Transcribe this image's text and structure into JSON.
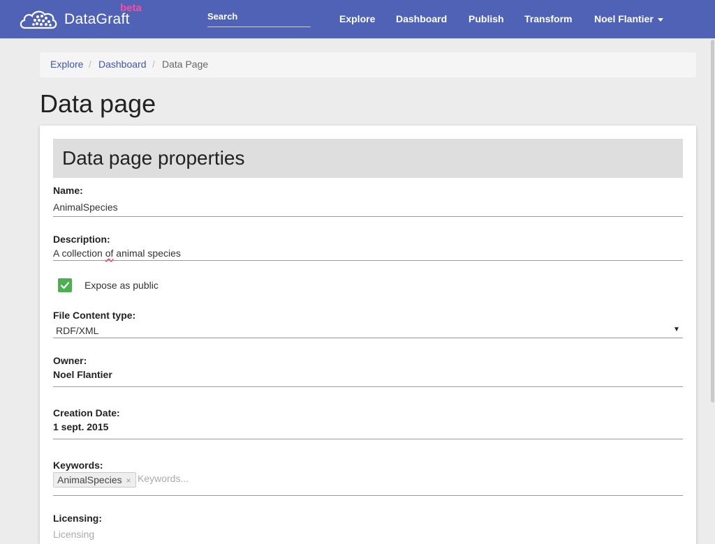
{
  "navbar": {
    "brand": "DataGraft",
    "badge": "beta",
    "search_placeholder": "Search",
    "links": [
      "Explore",
      "Dashboard",
      "Publish",
      "Transform"
    ],
    "user": "Noel Flantier",
    "logo_icon": "cloud-network-icon",
    "color": "#4f62b5",
    "badge_color": "#ff4aa0"
  },
  "breadcrumb": {
    "items": [
      "Explore",
      "Dashboard"
    ],
    "current": "Data Page",
    "separator": "/"
  },
  "page": {
    "title": "Data page"
  },
  "form": {
    "header": "Data page properties",
    "name_label": "Name:",
    "name_value": "AnimalSpecies",
    "description_label": "Description:",
    "description_prefix": "A collection ",
    "description_flagged": "of",
    "description_suffix": " animal species",
    "public_label": "Expose as public",
    "public_checked": true,
    "content_type_label": "File Content type:",
    "content_type_value": "RDF/XML",
    "owner_label": "Owner:",
    "owner_value": "Noel Flantier",
    "creation_date_label": "Creation Date:",
    "creation_date_value": "1 sept. 2015",
    "keywords_label": "Keywords:",
    "keywords": [
      "AnimalSpecies"
    ],
    "keywords_placeholder": "Keywords...",
    "licensing_label": "Licensing:",
    "licensing_placeholder": "Licensing",
    "check_color": "#4caf50"
  }
}
